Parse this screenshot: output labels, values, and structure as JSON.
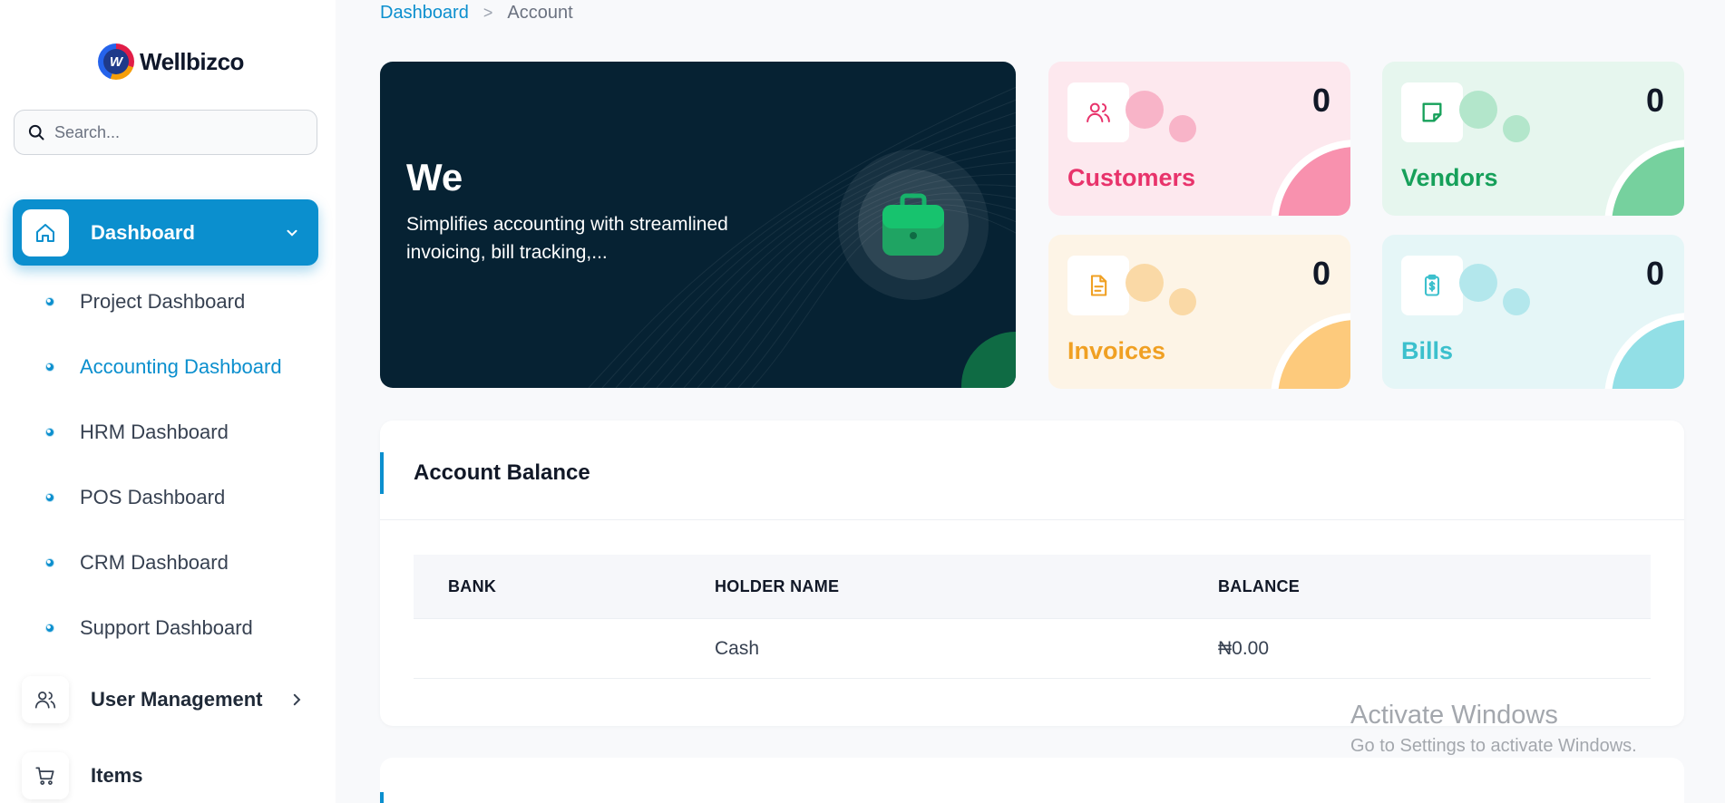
{
  "app": {
    "logo_text": "Wellbizco"
  },
  "search": {
    "placeholder": "Search..."
  },
  "sidebar": {
    "active_item": {
      "label": "Dashboard",
      "icon": "home-icon"
    },
    "sub_items": [
      {
        "label": "Project Dashboard"
      },
      {
        "label": "Accounting Dashboard"
      },
      {
        "label": "HRM Dashboard"
      },
      {
        "label": "POS Dashboard"
      },
      {
        "label": "CRM Dashboard"
      },
      {
        "label": "Support Dashboard"
      }
    ],
    "items": [
      {
        "label": "User Management",
        "icon": "users-icon"
      },
      {
        "label": "Items",
        "icon": "cart-icon"
      }
    ]
  },
  "breadcrumb": {
    "parent": "Dashboard",
    "separator": ">",
    "current": "Account"
  },
  "hero": {
    "title": "We",
    "text": "Simplifies accounting with streamlined invoicing, bill tracking,...",
    "icon": "briefcase-icon"
  },
  "stats": {
    "customers": {
      "label": "Customers",
      "value": "0",
      "icon": "users-icon",
      "color": "#e8336b"
    },
    "vendors": {
      "label": "Vendors",
      "value": "0",
      "icon": "note-icon",
      "color": "#16a05a"
    },
    "invoices": {
      "label": "Invoices",
      "value": "0",
      "icon": "file-icon",
      "color": "#f0a023"
    },
    "bills": {
      "label": "Bills",
      "value": "0",
      "icon": "receipt-dollar-icon",
      "color": "#3cc0cd"
    }
  },
  "account_balance": {
    "title": "Account Balance",
    "headers": {
      "bank": "BANK",
      "holder": "HOLDER NAME",
      "balance": "BALANCE"
    },
    "rows": [
      {
        "bank": "",
        "holder": "Cash",
        "balance": "₦0.00"
      }
    ]
  },
  "watermark": {
    "line1": "Activate Windows",
    "line2": "Go to Settings to activate Windows."
  },
  "colors": {
    "accent": "#0b8fce",
    "hero_bg": "#062233"
  }
}
